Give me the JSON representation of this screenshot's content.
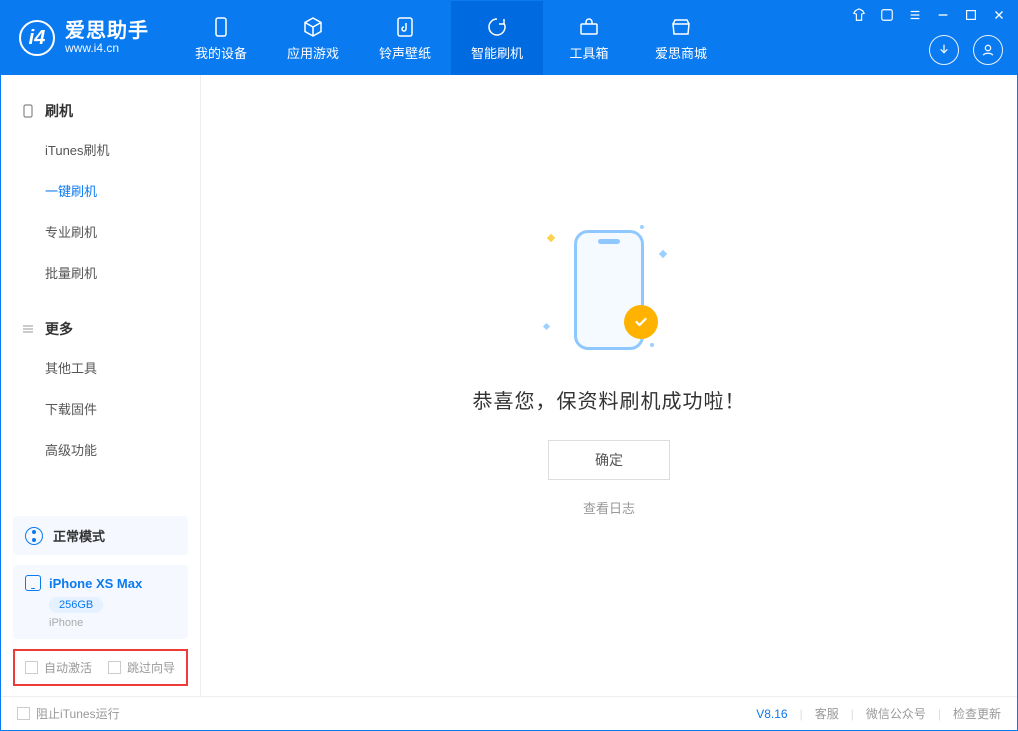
{
  "brand": {
    "title": "爱思助手",
    "subtitle": "www.i4.cn"
  },
  "tabs": {
    "device": "我的设备",
    "apps": "应用游戏",
    "ring": "铃声壁纸",
    "flash": "智能刷机",
    "tools": "工具箱",
    "store": "爱思商城"
  },
  "sidebar": {
    "group1": {
      "title": "刷机",
      "items": [
        "iTunes刷机",
        "一键刷机",
        "专业刷机",
        "批量刷机"
      ]
    },
    "group2": {
      "title": "更多",
      "items": [
        "其他工具",
        "下载固件",
        "高级功能"
      ]
    },
    "mode": "正常模式",
    "device": {
      "name": "iPhone XS Max",
      "capacity": "256GB",
      "type": "iPhone"
    },
    "checks": {
      "auto_activate": "自动激活",
      "skip_guide": "跳过向导"
    }
  },
  "result": {
    "title": "恭喜您，保资料刷机成功啦！",
    "ok": "确定",
    "view_log": "查看日志"
  },
  "status": {
    "block_itunes": "阻止iTunes运行",
    "version": "V8.16",
    "support": "客服",
    "wechat": "微信公众号",
    "update": "检查更新"
  }
}
